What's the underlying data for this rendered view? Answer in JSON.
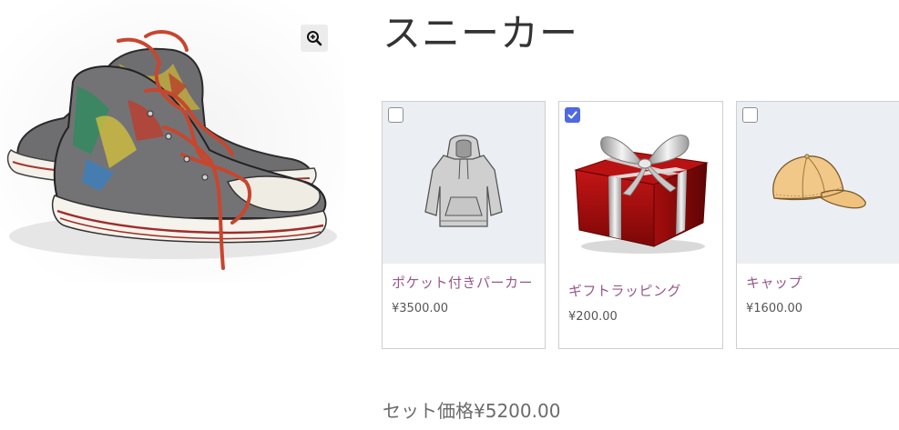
{
  "product": {
    "title": "スニーカー"
  },
  "gallery": {
    "main_image": "sneakers-photo",
    "zoom_icon": "magnifier-plus-icon"
  },
  "bundle": {
    "items": [
      {
        "name": "ポケット付きパーカー",
        "price": "¥3500.00",
        "checked": false,
        "image": "hoodie-image"
      },
      {
        "name": "ギフトラッピング",
        "price": "¥200.00",
        "checked": true,
        "image": "gift-box-image"
      },
      {
        "name": "キャップ",
        "price": "¥1600.00",
        "checked": false,
        "image": "cap-image"
      }
    ],
    "set_price_label": "セット価格¥5200.00"
  },
  "colors": {
    "link": "#96588a",
    "checkbox_checked": "#4f69e0",
    "card_image_bg": "#ebeff4"
  }
}
